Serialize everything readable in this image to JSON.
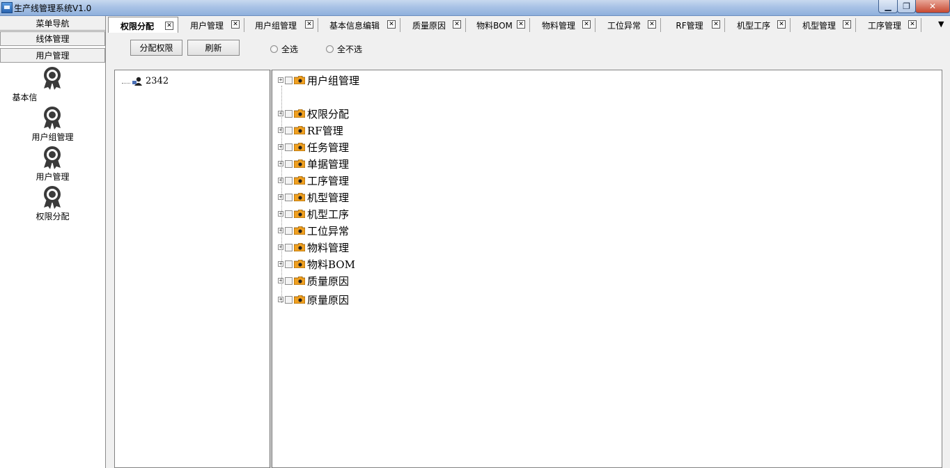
{
  "window": {
    "title": "生产线管理系统V1.0",
    "min_symbol": "▁",
    "max_symbol": "❐",
    "close_symbol": "✕"
  },
  "nav": {
    "header": "菜单导航",
    "groups": [
      "线体管理",
      "用户管理"
    ],
    "items": [
      {
        "label": "基本信",
        "icon": "award-icon"
      },
      {
        "label": "用户组管理",
        "icon": "award-icon"
      },
      {
        "label": "用户管理",
        "icon": "award-icon"
      },
      {
        "label": "权限分配",
        "icon": "award-icon"
      }
    ]
  },
  "tabs": [
    {
      "label": "权限分配",
      "active": true
    },
    {
      "label": "用户管理"
    },
    {
      "label": "用户组管理"
    },
    {
      "label": "基本信息编辑"
    },
    {
      "label": "质量原因"
    },
    {
      "label": "物料BOM"
    },
    {
      "label": "物料管理"
    },
    {
      "label": "工位异常"
    },
    {
      "label": "RF管理"
    },
    {
      "label": "机型工序"
    },
    {
      "label": "机型管理"
    },
    {
      "label": "工序管理"
    }
  ],
  "tab_close_symbol": "✕",
  "tab_overflow_symbol": "▼",
  "toolbar": {
    "assign_label": "分配权限",
    "refresh_label": "刷新",
    "select_all_label": "全选",
    "select_none_label": "全不选"
  },
  "user_tree": {
    "node": "2342"
  },
  "permission_tree": {
    "expander_symbol": "+",
    "items": [
      "用户组管理",
      "权限分配",
      "RF管理",
      "任务管理",
      "单据管理",
      "工序管理",
      "机型管理",
      "机型工序",
      "工位异常",
      "物料管理",
      "物料BOM",
      "质量原因",
      "原量原因"
    ]
  },
  "colors": {
    "titlebar": "#a9c3e6",
    "folder": "#f0a020",
    "icon_dark": "#3a3a3a"
  }
}
